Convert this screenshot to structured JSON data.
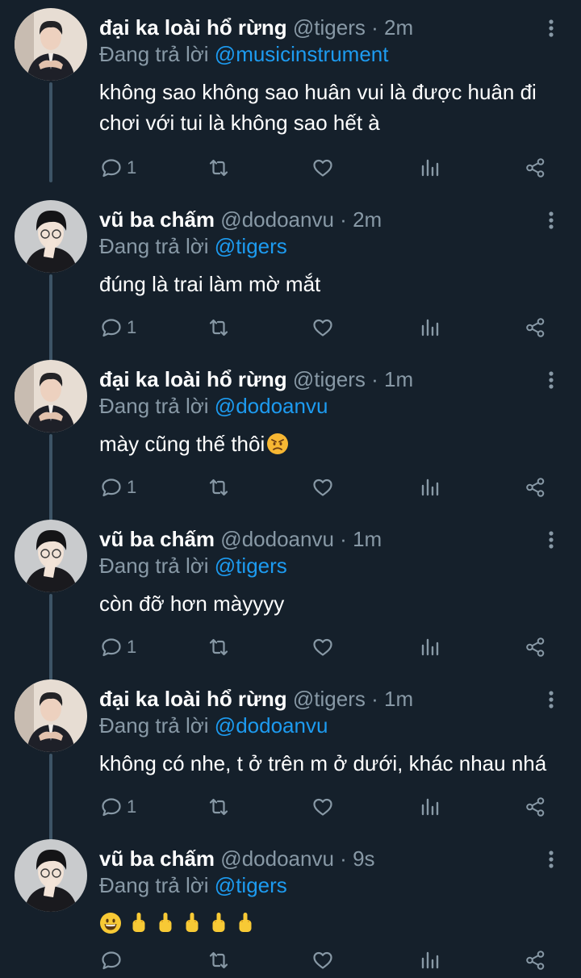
{
  "colors": {
    "background": "#15202b",
    "text_primary": "#ffffff",
    "text_secondary": "#8899a6",
    "accent": "#1d9bf0",
    "thread_line": "#3d5466"
  },
  "tweets": [
    {
      "name": "đại ka loài hổ rừng",
      "handle": "@tigers",
      "time": "2m",
      "reply_prefix": "Đang trả lời",
      "reply_to": "@musicinstrument",
      "text": "không sao không sao huân vui là được huân đi chơi với tui là không sao hết à",
      "reply_count": "1"
    },
    {
      "name": "vũ ba chấm",
      "handle": "@dodoanvu",
      "time": "2m",
      "reply_prefix": "Đang trả lời",
      "reply_to": "@tigers",
      "text": "đúng là trai làm mờ mắt",
      "reply_count": "1"
    },
    {
      "name": "đại ka loài hổ rừng",
      "handle": "@tigers",
      "time": "1m",
      "reply_prefix": "Đang trả lời",
      "reply_to": "@dodoanvu",
      "text": "mày cũng thế thôi",
      "reply_count": "1"
    },
    {
      "name": "vũ ba chấm",
      "handle": "@dodoanvu",
      "time": "1m",
      "reply_prefix": "Đang trả lời",
      "reply_to": "@tigers",
      "text": "còn đỡ hơn màyyyy",
      "reply_count": "1"
    },
    {
      "name": "đại ka loài hổ rừng",
      "handle": "@tigers",
      "time": "1m",
      "reply_prefix": "Đang trả lời",
      "reply_to": "@dodoanvu",
      "text": "không có nhe, t ở trên m ở dưới, khác nhau nhá",
      "reply_count": "1"
    },
    {
      "name": "vũ ba chấm",
      "handle": "@dodoanvu",
      "time": "9s",
      "reply_prefix": "Đang trả lời",
      "reply_to": "@tigers",
      "text": "",
      "reply_count": ""
    }
  ],
  "emoji": {
    "tweet3": [
      "angry-face"
    ],
    "tweet6": [
      "grinning-face",
      "middle-finger",
      "middle-finger",
      "middle-finger",
      "middle-finger",
      "middle-finger"
    ]
  },
  "icons": [
    "more-vertical-icon",
    "reply-icon",
    "retweet-icon",
    "like-icon",
    "analytics-icon",
    "share-icon"
  ]
}
